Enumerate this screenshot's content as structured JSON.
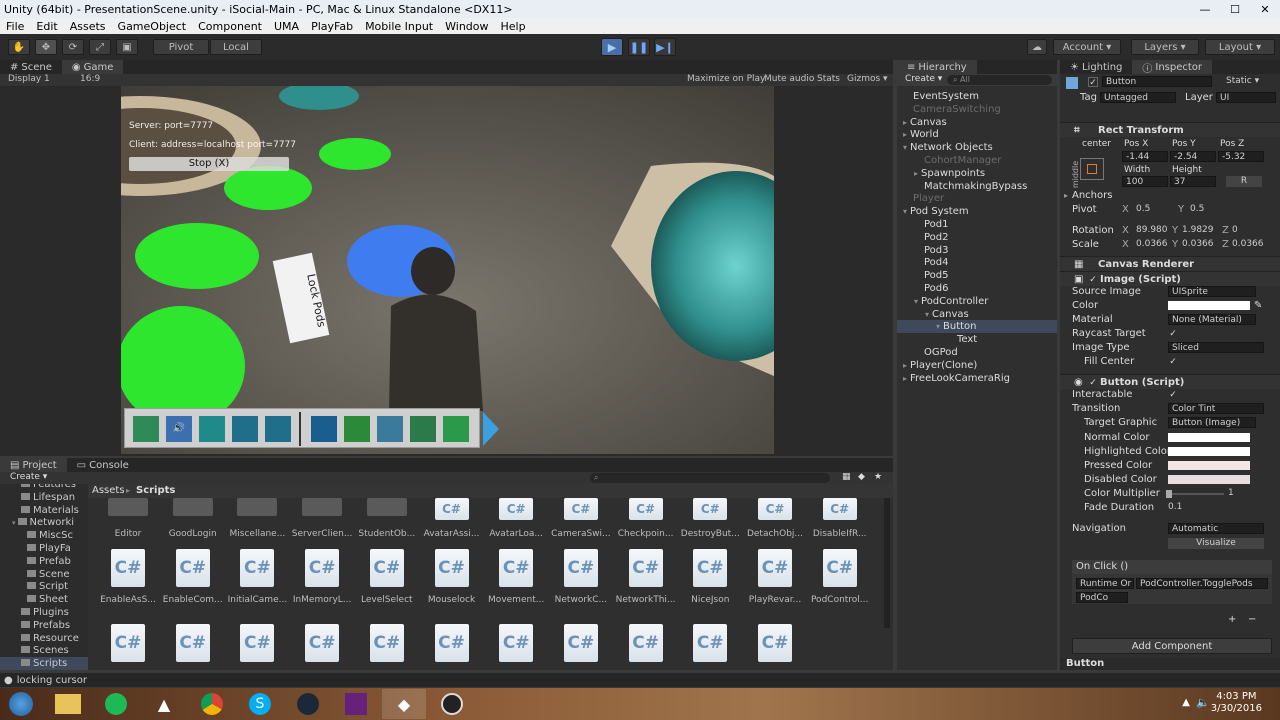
{
  "window": {
    "title": "Unity (64bit) - PresentationScene.unity - iSocial-Main - PC, Mac & Linux Standalone <DX11>",
    "minimize": "—",
    "maximize": "☐",
    "close": "✕"
  },
  "menu": [
    "File",
    "Edit",
    "Assets",
    "GameObject",
    "Component",
    "UMA",
    "PlayFab",
    "Mobile Input",
    "Window",
    "Help"
  ],
  "toolbar": {
    "pivot": "Pivot",
    "local": "Local",
    "account": "Account ▾",
    "layers": "Layers ▾",
    "layout": "Layout ▾"
  },
  "scene_tabs": {
    "scene": "Scene",
    "game": "Game",
    "display": "Display 1",
    "aspect": "16:9"
  },
  "game_options": [
    "Maximize on Play",
    "Mute audio",
    "Stats",
    "Gizmos ▾"
  ],
  "overlay": {
    "server": "Server: port=7777",
    "client": "Client: address=localhost port=7777",
    "stop": "Stop (X)",
    "sign": "Lock Pods"
  },
  "hierarchy": {
    "tab": "Hierarchy",
    "create": "Create ▾",
    "search": "All",
    "items": [
      {
        "label": "EventSystem",
        "indent": 0
      },
      {
        "label": "CameraSwitching",
        "indent": 0,
        "dim": true
      },
      {
        "label": "Canvas",
        "indent": 0,
        "arrow": "▸"
      },
      {
        "label": "World",
        "indent": 0,
        "arrow": "▸"
      },
      {
        "label": "Network Objects",
        "indent": 0,
        "arrow": "▾"
      },
      {
        "label": "CohortManager",
        "indent": 1,
        "dim": true
      },
      {
        "label": "Spawnpoints",
        "indent": 1,
        "arrow": "▸"
      },
      {
        "label": "MatchmakingBypass",
        "indent": 1
      },
      {
        "label": "Player",
        "indent": 0,
        "dim": true
      },
      {
        "label": "Pod System",
        "indent": 0,
        "arrow": "▾"
      },
      {
        "label": "Pod1",
        "indent": 1
      },
      {
        "label": "Pod2",
        "indent": 1
      },
      {
        "label": "Pod3",
        "indent": 1
      },
      {
        "label": "Pod4",
        "indent": 1
      },
      {
        "label": "Pod5",
        "indent": 1
      },
      {
        "label": "Pod6",
        "indent": 1
      },
      {
        "label": "PodController",
        "indent": 1,
        "arrow": "▾"
      },
      {
        "label": "Canvas",
        "indent": 2,
        "arrow": "▾"
      },
      {
        "label": "Button",
        "indent": 3,
        "selected": true,
        "arrow": "▾"
      },
      {
        "label": "Text",
        "indent": 4
      },
      {
        "label": "OGPod",
        "indent": 1
      },
      {
        "label": "Player(Clone)",
        "indent": 0,
        "arrow": "▸"
      },
      {
        "label": "FreeLookCameraRig",
        "indent": 0,
        "arrow": "▸"
      }
    ]
  },
  "inspector": {
    "tabs": {
      "lighting": "Lighting",
      "inspector": "Inspector"
    },
    "object_name": "Button",
    "static": "Static ▾",
    "tag_label": "Tag",
    "tag": "Untagged",
    "layer_label": "Layer",
    "layer": "UI",
    "rect_transform": "Rect Transform",
    "anchor_preset": "center",
    "middle": "middle",
    "pos_x_label": "Pos X",
    "pos_y_label": "Pos Y",
    "pos_z_label": "Pos Z",
    "pos_x": "-1.44",
    "pos_y": "-2.54",
    "pos_z": "-5.32",
    "width_label": "Width",
    "height_label": "Height",
    "width": "100",
    "height": "37",
    "r_button": "R",
    "anchors": "Anchors",
    "pivot_label": "Pivot",
    "pivot_x": "0.5",
    "pivot_y": "0.5",
    "rotation_label": "Rotation",
    "rot_x": "89.980",
    "rot_y": "1.9829",
    "rot_z": "0",
    "scale_label": "Scale",
    "scale_x": "0.0366",
    "scale_y": "0.0366",
    "scale_z": "0.0366",
    "canvas_renderer": "Canvas Renderer",
    "image_script": "Image (Script)",
    "source_image_label": "Source Image",
    "source_image": "UISprite",
    "color_label": "Color",
    "material_label": "Material",
    "material": "None (Material)",
    "raycast_label": "Raycast Target",
    "image_type_label": "Image Type",
    "image_type": "Sliced",
    "fill_center_label": "Fill Center",
    "button_script": "Button (Script)",
    "interactable_label": "Interactable",
    "transition_label": "Transition",
    "transition": "Color Tint",
    "target_graphic_label": "Target Graphic",
    "target_graphic": "Button (Image)",
    "normal_color_label": "Normal Color",
    "highlighted_color_label": "Highlighted Color",
    "pressed_color_label": "Pressed Color",
    "disabled_color_label": "Disabled Color",
    "multiplier_label": "Color Multiplier",
    "multiplier": "1",
    "fade_label": "Fade Duration",
    "fade": "0.1",
    "navigation_label": "Navigation",
    "navigation": "Automatic",
    "visualize": "Visualize",
    "onclick": "On Click ()",
    "runtime": "Runtime Or",
    "function": "PodController.TogglePods",
    "target_obj": "PodCo",
    "add_component": "Add Component",
    "footer_name": "Button"
  },
  "project": {
    "tabs": {
      "project": "Project",
      "console": "Console"
    },
    "create": "Create ▾",
    "breadcrumb_root": "Assets",
    "breadcrumb_sep": "▸",
    "breadcrumb_current": "Scripts",
    "tree": [
      {
        "label": "Features",
        "indent": 2
      },
      {
        "label": "Lifespan",
        "indent": 2
      },
      {
        "label": "Materials",
        "indent": 2
      },
      {
        "label": "Networki",
        "indent": 2,
        "arrow": "▾"
      },
      {
        "label": "MiscSc",
        "indent": 3
      },
      {
        "label": "PlayFa",
        "indent": 3
      },
      {
        "label": "Prefab",
        "indent": 3
      },
      {
        "label": "Scene",
        "indent": 3
      },
      {
        "label": "Script",
        "indent": 3
      },
      {
        "label": "Sheet",
        "indent": 3
      },
      {
        "label": "Plugins",
        "indent": 2
      },
      {
        "label": "Prefabs",
        "indent": 2
      },
      {
        "label": "Resource",
        "indent": 2
      },
      {
        "label": "Scenes",
        "indent": 2
      },
      {
        "label": "Scripts",
        "indent": 2,
        "selected": true
      }
    ],
    "row1": [
      {
        "label": "Editor",
        "kind": "folder"
      },
      {
        "label": "GoodLogin",
        "kind": "folder"
      },
      {
        "label": "Miscellane...",
        "kind": "folder"
      },
      {
        "label": "ServerClien...",
        "kind": "folder"
      },
      {
        "label": "StudentOb...",
        "kind": "folder"
      },
      {
        "label": "AvatarAssi...",
        "kind": "cs"
      },
      {
        "label": "AvatarLoa...",
        "kind": "cs"
      },
      {
        "label": "CameraSwi...",
        "kind": "cs"
      },
      {
        "label": "Checkpoin...",
        "kind": "cs"
      },
      {
        "label": "DestroyBut...",
        "kind": "cs"
      },
      {
        "label": "DetachObj...",
        "kind": "cs"
      },
      {
        "label": "DisableIfR...",
        "kind": "cs"
      }
    ],
    "row2": [
      {
        "label": "EnableAsS..."
      },
      {
        "label": "EnableCom..."
      },
      {
        "label": "InitialCame..."
      },
      {
        "label": "InMemoryL..."
      },
      {
        "label": "LevelSelect"
      },
      {
        "label": "Mouselock"
      },
      {
        "label": "Movement..."
      },
      {
        "label": "NetworkC..."
      },
      {
        "label": "NetworkThi..."
      },
      {
        "label": "NiceJson"
      },
      {
        "label": "PlayRevar..."
      },
      {
        "label": "PodControl..."
      }
    ],
    "cs_glyph": "C#"
  },
  "status": "locking cursor",
  "taskbar": {
    "time": "4:03 PM",
    "date": "3/30/2016"
  }
}
